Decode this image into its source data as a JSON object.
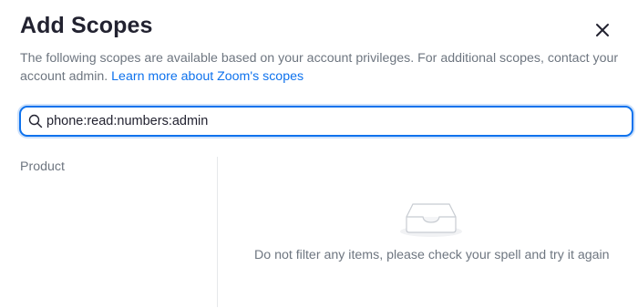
{
  "dialog": {
    "title": "Add Scopes",
    "description": "The following scopes are available based on your account privileges. For additional scopes, contact your account admin.",
    "learn_more_link": "Learn more about Zoom's scopes",
    "close_icon": "close-icon"
  },
  "search": {
    "value": "phone:read:numbers:admin",
    "icon": "search-icon"
  },
  "sidebar": {
    "label": "Product"
  },
  "empty_state": {
    "icon": "empty-tray-icon",
    "message": "Do not filter any items, please check your spell and try it again"
  },
  "colors": {
    "accent": "#0e72ed",
    "text_primary": "#222230",
    "text_secondary": "#6e7680"
  }
}
